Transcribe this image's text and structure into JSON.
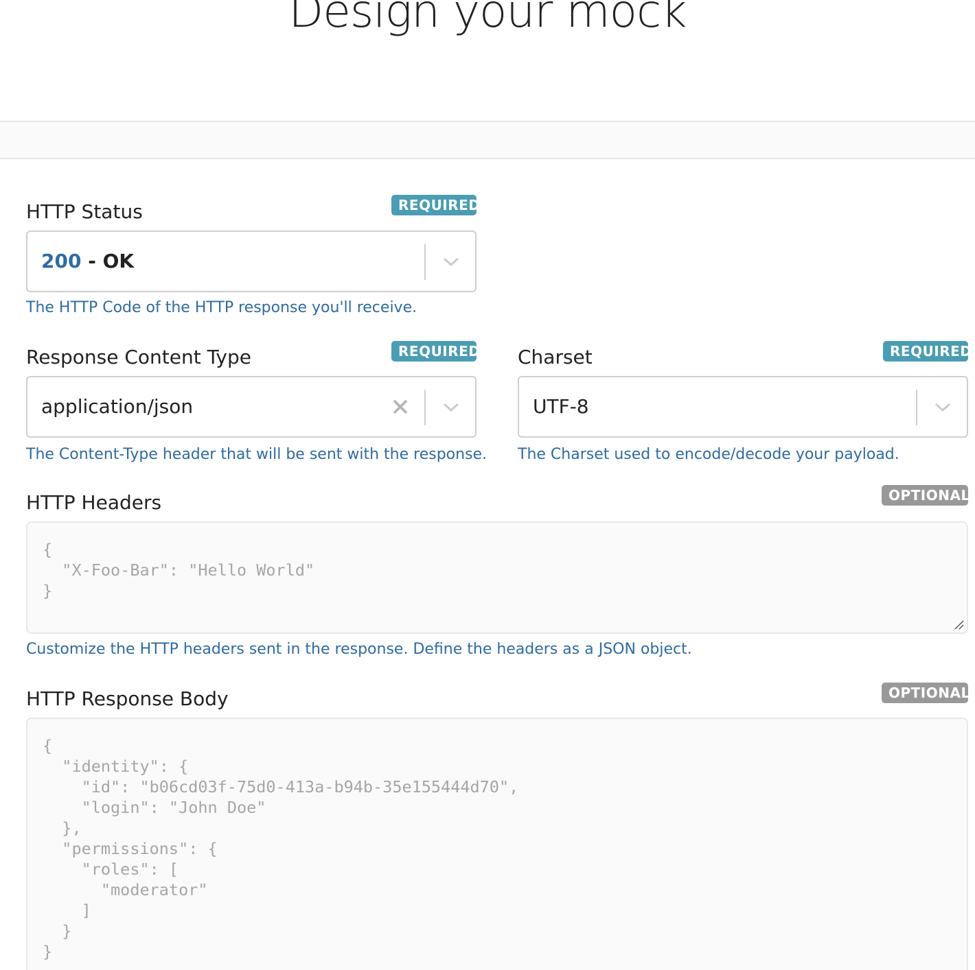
{
  "page": {
    "title": "Design your mock"
  },
  "http_status": {
    "label": "HTTP Status",
    "badge": "REQUIRED",
    "code": "200",
    "separator": " - ",
    "text": "OK",
    "help": "The HTTP Code of the HTTP response you'll receive."
  },
  "content_type": {
    "label": "Response Content Type",
    "badge": "REQUIRED",
    "value": "application/json",
    "help": "The Content-Type header that will be sent with the response."
  },
  "charset": {
    "label": "Charset",
    "badge": "REQUIRED",
    "value": "UTF-8",
    "help": "The Charset used to encode/decode your payload."
  },
  "headers": {
    "label": "HTTP Headers",
    "badge": "OPTIONAL",
    "placeholder": "{\n  \"X-Foo-Bar\": \"Hello World\"\n}",
    "help": "Customize the HTTP headers sent in the response. Define the headers as a JSON object."
  },
  "body": {
    "label": "HTTP Response Body",
    "badge": "OPTIONAL",
    "placeholder": "{\n  \"identity\": {\n    \"id\": \"b06cd03f-75d0-413a-b94b-35e155444d70\",\n    \"login\": \"John Doe\"\n  },\n  \"permissions\": {\n    \"roles\": [\n      \"moderator\"\n    ]\n  }\n}"
  },
  "colors": {
    "required_badge": "#4a9db3",
    "optional_badge": "#999999",
    "help_text": "#2f6ba1",
    "status_code": "#2f6ba1"
  },
  "icons": {
    "dropdown": "chevron-down-icon",
    "clear": "close-icon",
    "resize": "resize-handle-icon"
  }
}
